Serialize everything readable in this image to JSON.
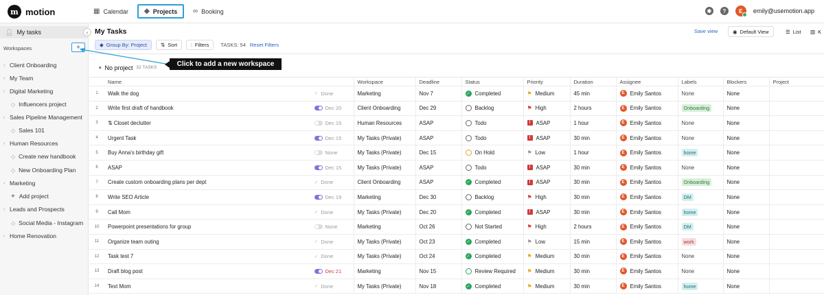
{
  "app": {
    "name": "motion",
    "logo_letter": "m"
  },
  "nav": {
    "tabs": [
      {
        "label": "Calendar",
        "icon": "calendar-icon",
        "active": false
      },
      {
        "label": "Projects",
        "icon": "projects-icon",
        "active": true
      },
      {
        "label": "Booking",
        "icon": "link-icon",
        "active": false
      }
    ]
  },
  "user": {
    "email": "emily@usemotion.app",
    "initial": "E"
  },
  "sidebar": {
    "my_tasks": "My tasks",
    "workspaces_label": "Workspaces",
    "add_workspace": "+",
    "items": [
      {
        "label": "Client Onboarding",
        "kind": "workspace"
      },
      {
        "label": "My Team",
        "kind": "workspace"
      },
      {
        "label": "Digital Marketing",
        "kind": "workspace"
      },
      {
        "label": "Influencers project",
        "kind": "project"
      },
      {
        "label": "Sales Pipeline Management",
        "kind": "workspace"
      },
      {
        "label": "Sales 101",
        "kind": "project"
      },
      {
        "label": "Human Resources",
        "kind": "workspace"
      },
      {
        "label": "Create new handbook",
        "kind": "project"
      },
      {
        "label": "New Onboarding Plan",
        "kind": "project"
      },
      {
        "label": "Marketing",
        "kind": "workspace"
      },
      {
        "label": "Add project",
        "kind": "add"
      },
      {
        "label": "Leads and Prospects",
        "kind": "workspace"
      },
      {
        "label": "Social Media - Instagram",
        "kind": "project"
      },
      {
        "label": "Home Renovation",
        "kind": "workspace"
      }
    ]
  },
  "main": {
    "title": "My Tasks",
    "save_view": "Save view",
    "default_view": "Default View",
    "list_label": "List",
    "kanban_letter": "K",
    "toolbar": {
      "group_by": "Group By: Project",
      "sort": "Sort",
      "filters": "Filters",
      "tasks_count": "TASKS: 54",
      "reset_filters": "Reset Filters"
    },
    "group": {
      "name": "No project",
      "count": "32 TASKS"
    },
    "callout": "Click to add a new workspace"
  },
  "table": {
    "columns": [
      "Name",
      "Workspace",
      "Deadline",
      "Status",
      "Priority",
      "Duration",
      "Assignee",
      "Labels",
      "Blockers",
      "Project"
    ],
    "rows": [
      {
        "n": "1",
        "name": "Walk the dog",
        "done_state": "check",
        "due": "Done",
        "due_red": false,
        "workspace": "Marketing",
        "deadline": "Nov 7",
        "status": "Completed",
        "status_kind": "done",
        "priority": "Medium",
        "pri_kind": "medium",
        "duration": "45 min",
        "assignee": "Emily Santos",
        "label": "None",
        "label_kind": "",
        "blockers": "None"
      },
      {
        "n": "2",
        "name": "Write first draft of handbook",
        "done_state": "on",
        "due": "Dec 20",
        "due_red": false,
        "workspace": "Client Onboarding",
        "deadline": "Dec 29",
        "status": "Backlog",
        "status_kind": "open",
        "priority": "High",
        "pri_kind": "high",
        "duration": "2 hours",
        "assignee": "Emily Santos",
        "label": "Onboarding",
        "label_kind": "green",
        "blockers": "None"
      },
      {
        "n": "3",
        "name": "⇅ Closet declutter",
        "done_state": "off",
        "due": "Dec 15",
        "due_red": false,
        "workspace": "Human Resources",
        "deadline": "ASAP",
        "status": "Todo",
        "status_kind": "open",
        "priority": "ASAP",
        "pri_kind": "asap",
        "duration": "1 hour",
        "assignee": "Emily Santos",
        "label": "None",
        "label_kind": "",
        "blockers": "None"
      },
      {
        "n": "4",
        "name": "Urgent Task",
        "done_state": "on",
        "due": "Dec 15",
        "due_red": false,
        "workspace": "My Tasks (Private)",
        "deadline": "ASAP",
        "status": "Todo",
        "status_kind": "open",
        "priority": "ASAP",
        "pri_kind": "asap",
        "duration": "30 min",
        "assignee": "Emily Santos",
        "label": "None",
        "label_kind": "",
        "blockers": "None"
      },
      {
        "n": "5",
        "name": "Buy Anna's birthday gift",
        "done_state": "off",
        "due": "None",
        "due_red": false,
        "workspace": "My Tasks (Private)",
        "deadline": "Dec 15",
        "status": "On Hold",
        "status_kind": "hold",
        "priority": "Low",
        "pri_kind": "low",
        "duration": "1 hour",
        "assignee": "Emily Santos",
        "label": "home",
        "label_kind": "teal",
        "blockers": "None"
      },
      {
        "n": "6",
        "name": "ASAP",
        "done_state": "on",
        "due": "Dec 15",
        "due_red": false,
        "workspace": "My Tasks (Private)",
        "deadline": "ASAP",
        "status": "Todo",
        "status_kind": "open",
        "priority": "ASAP",
        "pri_kind": "asap",
        "duration": "30 min",
        "assignee": "Emily Santos",
        "label": "None",
        "label_kind": "",
        "blockers": "None"
      },
      {
        "n": "7",
        "name": "Create custom onboarding plans per dept",
        "done_state": "check",
        "due": "Done",
        "due_red": false,
        "workspace": "Client Onboarding",
        "deadline": "ASAP",
        "status": "Completed",
        "status_kind": "done",
        "priority": "ASAP",
        "pri_kind": "asap",
        "duration": "30 min",
        "assignee": "Emily Santos",
        "label": "Onboarding",
        "label_kind": "green",
        "blockers": "None"
      },
      {
        "n": "8",
        "name": "Write SEO Article",
        "done_state": "on",
        "due": "Dec 19",
        "due_red": false,
        "workspace": "Marketing",
        "deadline": "Dec 30",
        "status": "Backlog",
        "status_kind": "open",
        "priority": "High",
        "pri_kind": "high",
        "duration": "30 min",
        "assignee": "Emily Santos",
        "label": "DM",
        "label_kind": "teal",
        "blockers": "None"
      },
      {
        "n": "9",
        "name": "Call Mom",
        "done_state": "check",
        "due": "Done",
        "due_red": false,
        "workspace": "My Tasks (Private)",
        "deadline": "Dec 20",
        "status": "Completed",
        "status_kind": "done",
        "priority": "ASAP",
        "pri_kind": "asap",
        "duration": "30 min",
        "assignee": "Emily Santos",
        "label": "home",
        "label_kind": "teal",
        "blockers": "None"
      },
      {
        "n": "10",
        "name": "Powerpoint presentations for group",
        "done_state": "off",
        "due": "None",
        "due_red": false,
        "workspace": "Marketing",
        "deadline": "Oct 26",
        "status": "Not Started",
        "status_kind": "open",
        "priority": "High",
        "pri_kind": "high",
        "duration": "2 hours",
        "assignee": "Emily Santos",
        "label": "DM",
        "label_kind": "teal",
        "blockers": "None"
      },
      {
        "n": "11",
        "name": "Organize team outing",
        "done_state": "check",
        "due": "Done",
        "due_red": false,
        "workspace": "My Tasks (Private)",
        "deadline": "Oct 23",
        "status": "Completed",
        "status_kind": "done",
        "priority": "Low",
        "pri_kind": "low",
        "duration": "15 min",
        "assignee": "Emily Santos",
        "label": "work",
        "label_kind": "pink",
        "blockers": "None"
      },
      {
        "n": "12",
        "name": "Task test 7",
        "done_state": "check",
        "due": "Done",
        "due_red": false,
        "workspace": "My Tasks (Private)",
        "deadline": "Oct 24",
        "status": "Completed",
        "status_kind": "done",
        "priority": "Medium",
        "pri_kind": "medium",
        "duration": "30 min",
        "assignee": "Emily Santos",
        "label": "None",
        "label_kind": "",
        "blockers": "None"
      },
      {
        "n": "13",
        "name": "Draft blog post",
        "done_state": "on",
        "due": "Dec 21",
        "due_red": true,
        "workspace": "Marketing",
        "deadline": "Nov 15",
        "status": "Review Required",
        "status_kind": "review",
        "priority": "Medium",
        "pri_kind": "medium",
        "duration": "30 min",
        "assignee": "Emily Santos",
        "label": "None",
        "label_kind": "",
        "blockers": "None"
      },
      {
        "n": "14",
        "name": "Text Mom",
        "done_state": "check",
        "due": "Done",
        "due_red": false,
        "workspace": "My Tasks (Private)",
        "deadline": "Nov 18",
        "status": "Completed",
        "status_kind": "done",
        "priority": "Medium",
        "pri_kind": "medium",
        "duration": "30 min",
        "assignee": "Emily Santos",
        "label": "home",
        "label_kind": "teal",
        "blockers": "None"
      }
    ]
  }
}
